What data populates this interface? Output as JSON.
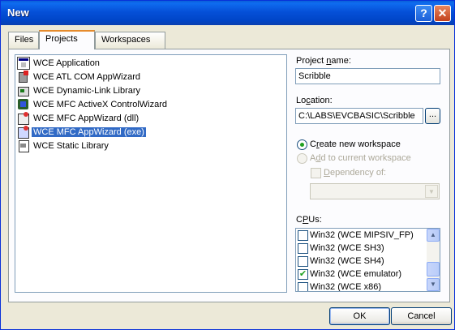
{
  "window": {
    "title": "New",
    "help_glyph": "?",
    "close_glyph": "✕"
  },
  "tabs": [
    {
      "label": "Files",
      "active": false
    },
    {
      "label": "Projects",
      "active": true
    },
    {
      "label": "Workspaces",
      "active": false
    }
  ],
  "project_list": [
    {
      "label": "WCE Application",
      "icon": "app-icon",
      "selected": false
    },
    {
      "label": "WCE ATL COM AppWizard",
      "icon": "atl-icon",
      "selected": false
    },
    {
      "label": "WCE Dynamic-Link Library",
      "icon": "dll-icon",
      "selected": false
    },
    {
      "label": "WCE MFC ActiveX ControlWizard",
      "icon": "activex-icon",
      "selected": false
    },
    {
      "label": "WCE MFC AppWizard (dll)",
      "icon": "mfc-dll-icon",
      "selected": false
    },
    {
      "label": "WCE MFC AppWizard (exe)",
      "icon": "mfc-exe-icon",
      "selected": true
    },
    {
      "label": "WCE Static Library",
      "icon": "static-lib-icon",
      "selected": false
    }
  ],
  "project_name": {
    "label_pre": "Project ",
    "label_u": "n",
    "label_post": "ame:",
    "value": "Scribble"
  },
  "location": {
    "label_pre": "Lo",
    "label_u": "c",
    "label_post": "ation:",
    "value": "C:\\LABS\\EVCBASIC\\Scribble",
    "browse_label": "..."
  },
  "workspace": {
    "create_pre": "C",
    "create_u": "r",
    "create_post": "eate new workspace",
    "add_pre": "A",
    "add_u": "d",
    "add_post": "d to current workspace",
    "dependency_pre": "",
    "dependency_u": "D",
    "dependency_post": "ependency of:",
    "selected": "create"
  },
  "cpus": {
    "label_pre": "C",
    "label_u": "P",
    "label_post": "Us:",
    "items": [
      {
        "label": "Win32 (WCE MIPSIV_FP)",
        "checked": false
      },
      {
        "label": "Win32 (WCE SH3)",
        "checked": false
      },
      {
        "label": "Win32 (WCE SH4)",
        "checked": false
      },
      {
        "label": "Win32 (WCE emulator)",
        "checked": true
      },
      {
        "label": "Win32 (WCE x86)",
        "checked": false
      }
    ],
    "check_glyph": "✔",
    "scroll_up": "▲",
    "scroll_down": "▼"
  },
  "combo_arrow": "▼",
  "buttons": {
    "ok": "OK",
    "cancel": "Cancel"
  }
}
